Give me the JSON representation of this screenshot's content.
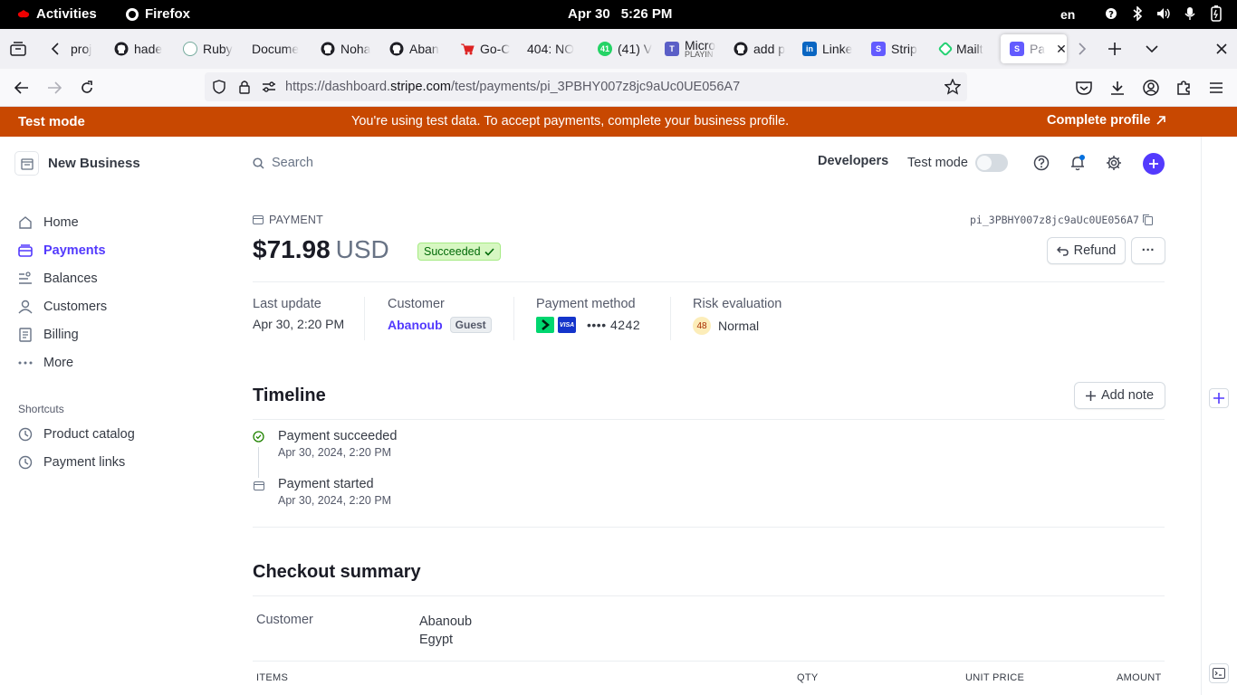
{
  "system_bar": {
    "activities": "Activities",
    "app": "Firefox",
    "date": "Apr 30",
    "time": "5:26 PM",
    "lang": "en"
  },
  "tabs": [
    {
      "label": "proj",
      "icon": "tab-favicon"
    },
    {
      "label": "hade",
      "icon": "github-icon"
    },
    {
      "label": "Ruby",
      "icon": "chatgpt-icon"
    },
    {
      "label": "Docume",
      "icon": "none"
    },
    {
      "label": "Noha",
      "icon": "github-icon"
    },
    {
      "label": "Aban",
      "icon": "github-icon"
    },
    {
      "label": "Go-C",
      "icon": "cart-icon"
    },
    {
      "label": "404: NO",
      "icon": "none"
    },
    {
      "label": "(41) V",
      "icon": "whatsapp-icon"
    },
    {
      "label": "Micro",
      "sub": "PLAYIN",
      "icon": "teams-icon"
    },
    {
      "label": "add p",
      "icon": "github-icon"
    },
    {
      "label": "Linke",
      "icon": "linkedin-icon"
    },
    {
      "label": "Strip",
      "icon": "stripe-icon"
    },
    {
      "label": "Mailt",
      "icon": "mailtrap-icon"
    },
    {
      "label": "Pa",
      "icon": "stripe-icon",
      "active": true
    }
  ],
  "url": {
    "prefix": "https://dashboard.",
    "domain": "stripe.com",
    "path": "/test/payments/pi_3PBHY007z8jc9aUc0UE056A7"
  },
  "banner": {
    "title": "Test mode",
    "message": "You're using test data. To accept payments, complete your business profile.",
    "cta": "Complete profile",
    "color": "#c84801"
  },
  "sidebar": {
    "business": "New Business",
    "items": [
      {
        "label": "Home",
        "icon": "home-icon"
      },
      {
        "label": "Payments",
        "icon": "payments-icon",
        "active": true
      },
      {
        "label": "Balances",
        "icon": "balances-icon"
      },
      {
        "label": "Customers",
        "icon": "customers-icon"
      },
      {
        "label": "Billing",
        "icon": "billing-icon"
      },
      {
        "label": "More",
        "icon": "more-icon"
      }
    ],
    "shortcuts_label": "Shortcuts",
    "shortcuts": [
      {
        "label": "Product catalog",
        "icon": "clock-icon"
      },
      {
        "label": "Payment links",
        "icon": "clock-icon"
      }
    ]
  },
  "header": {
    "search_placeholder": "Search",
    "developers": "Developers",
    "test_mode": "Test mode",
    "accent": "#533afd"
  },
  "payment": {
    "kicker": "PAYMENT",
    "id": "pi_3PBHY007z8jc9aUc0UE056A7",
    "amount": "$71.98",
    "currency": "USD",
    "status": "Succeeded",
    "refund": "Refund",
    "more": "···",
    "meta": {
      "last_update_label": "Last update",
      "last_update": "Apr 30, 2:20 PM",
      "customer_label": "Customer",
      "customer": "Abanoub",
      "guest": "Guest",
      "method_label": "Payment method",
      "card": "•••• 4242",
      "risk_label": "Risk evaluation",
      "risk_score": "48",
      "risk_level": "Normal"
    }
  },
  "timeline": {
    "title": "Timeline",
    "add_note": "Add note",
    "events": [
      {
        "title": "Payment succeeded",
        "date": "Apr 30, 2024, 2:20 PM"
      },
      {
        "title": "Payment started",
        "date": "Apr 30, 2024, 2:20 PM"
      }
    ]
  },
  "checkout": {
    "title": "Checkout summary",
    "customer_label": "Customer",
    "customer_name": "Abanoub",
    "customer_country": "Egypt",
    "columns": [
      "ITEMS",
      "QTY",
      "UNIT PRICE",
      "AMOUNT"
    ]
  }
}
